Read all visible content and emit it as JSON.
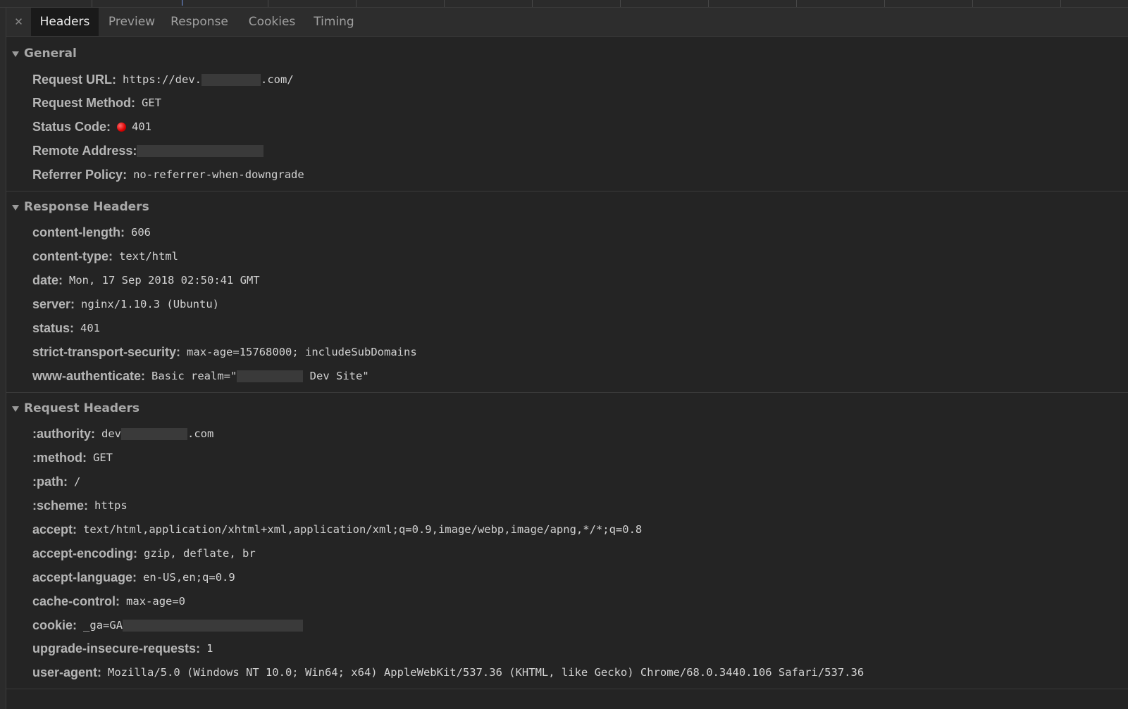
{
  "tabs": [
    {
      "label": "Headers",
      "active": true
    },
    {
      "label": "Preview",
      "active": false
    },
    {
      "label": "Response",
      "active": false
    },
    {
      "label": "Cookies",
      "active": false
    },
    {
      "label": "Timing",
      "active": false
    }
  ],
  "close_icon": "close-icon",
  "colors": {
    "status_error": "#e00000",
    "background": "#242424",
    "active_tab": "#1a1a1a"
  },
  "sections": {
    "general": {
      "title": "General",
      "rows": {
        "request_url": {
          "key": "Request URL:",
          "val_prefix": "https://dev.",
          "val_suffix": ".com/"
        },
        "request_method": {
          "key": "Request Method:",
          "val": "GET"
        },
        "status_code": {
          "key": "Status Code:",
          "val": "401"
        },
        "remote_address": {
          "key": "Remote Address:"
        },
        "referrer_policy": {
          "key": "Referrer Policy:",
          "val": "no-referrer-when-downgrade"
        }
      }
    },
    "response_headers": {
      "title": "Response Headers",
      "rows": [
        {
          "key": "content-length:",
          "val": "606"
        },
        {
          "key": "content-type:",
          "val": "text/html"
        },
        {
          "key": "date:",
          "val": "Mon, 17 Sep 2018 02:50:41 GMT"
        },
        {
          "key": "server:",
          "val": "nginx/1.10.3 (Ubuntu)"
        },
        {
          "key": "status:",
          "val": "401"
        },
        {
          "key": "strict-transport-security:",
          "val": "max-age=15768000; includeSubDomains"
        }
      ],
      "www_authenticate": {
        "key": "www-authenticate:",
        "val_prefix": "Basic realm=\"",
        "val_suffix": " Dev Site\""
      }
    },
    "request_headers": {
      "title": "Request Headers",
      "authority": {
        "key": ":authority:",
        "val_prefix": "dev",
        "val_suffix": ".com"
      },
      "rows": [
        {
          "key": ":method:",
          "val": "GET"
        },
        {
          "key": ":path:",
          "val": "/"
        },
        {
          "key": ":scheme:",
          "val": "https"
        },
        {
          "key": "accept:",
          "val": "text/html,application/xhtml+xml,application/xml;q=0.9,image/webp,image/apng,*/*;q=0.8"
        },
        {
          "key": "accept-encoding:",
          "val": "gzip, deflate, br"
        },
        {
          "key": "accept-language:",
          "val": "en-US,en;q=0.9"
        },
        {
          "key": "cache-control:",
          "val": "max-age=0"
        }
      ],
      "cookie": {
        "key": "cookie:",
        "val_prefix": "_ga=GA"
      },
      "rows_after": [
        {
          "key": "upgrade-insecure-requests:",
          "val": "1"
        },
        {
          "key": "user-agent:",
          "val": "Mozilla/5.0 (Windows NT 10.0; Win64; x64) AppleWebKit/537.36 (KHTML, like Gecko) Chrome/68.0.3440.106 Safari/537.36"
        }
      ]
    }
  }
}
